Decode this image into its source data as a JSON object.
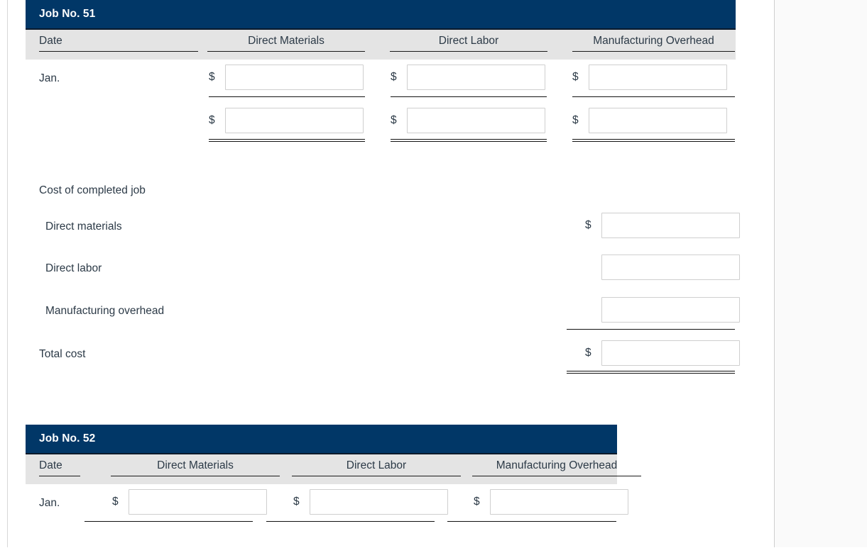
{
  "jobs": [
    {
      "title": "Job No. 51",
      "columns": [
        "Date",
        "Direct Materials",
        "Direct Labor",
        "Manufacturing Overhead"
      ],
      "rows": [
        {
          "date": "Jan.",
          "currency": "$",
          "materials": "",
          "labor": "",
          "overhead": ""
        },
        {
          "date": "",
          "currency": "$",
          "materials": "",
          "labor": "",
          "overhead": ""
        }
      ],
      "summary": {
        "heading": "Cost of completed job",
        "items": [
          {
            "label": "Direct materials",
            "currency": "$",
            "value": ""
          },
          {
            "label": "Direct labor",
            "currency": "",
            "value": ""
          },
          {
            "label": "Manufacturing overhead",
            "currency": "",
            "value": ""
          }
        ],
        "total": {
          "label": "Total cost",
          "currency": "$",
          "value": ""
        }
      }
    },
    {
      "title": "Job No. 52",
      "columns": [
        "Date",
        "Direct Materials",
        "Direct Labor",
        "Manufacturing Overhead"
      ],
      "rows": [
        {
          "date": "Jan.",
          "currency": "$",
          "materials": "",
          "labor": "",
          "overhead": ""
        }
      ]
    }
  ],
  "input_placeholder": ""
}
